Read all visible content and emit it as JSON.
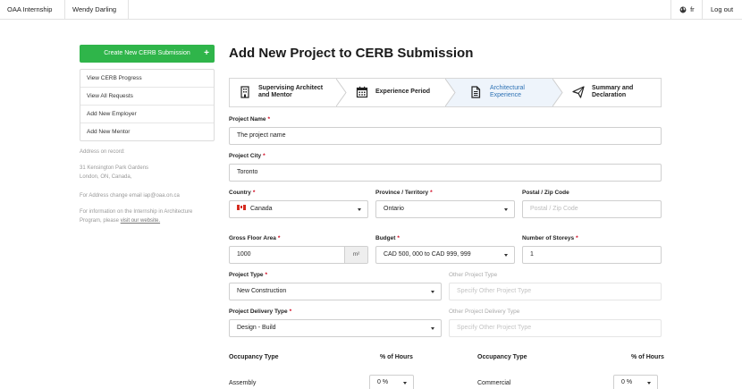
{
  "topbar": {
    "brand": "OAA Internship",
    "user": "Wendy Darling",
    "lang": "fr",
    "logout": "Log out"
  },
  "sidebar": {
    "create_button": "Create New CERB Submission",
    "create_icon": "+",
    "menu": [
      "View CERB Progress",
      "View All Requests",
      "Add New Employer",
      "Add New Mentor"
    ],
    "address_heading": "Address on record:",
    "address_line1": "31 Kensington Park Gardens",
    "address_line2": "London, ON, Canada,",
    "address_change": "For Address change email iap@oaa.on.ca",
    "info_line1": "For information on the Internship in Architecture",
    "info_line2_prefix": "Program, please ",
    "info_link": "visit our website."
  },
  "page": {
    "title": "Add New Project to CERB Submission"
  },
  "steps": [
    {
      "line1": "Supervising Architect",
      "line2": "and Mentor",
      "icon": "building-icon"
    },
    {
      "line1": "Experience Period",
      "line2": "",
      "icon": "calendar-icon"
    },
    {
      "line1": "Architectural",
      "line2": "Experience",
      "icon": "document-icon"
    },
    {
      "line1": "Summary and",
      "line2": "Declaration",
      "icon": "paper-plane-icon"
    }
  ],
  "form": {
    "project_name": {
      "label": "Project Name",
      "req": "*",
      "value": "The project name"
    },
    "project_city": {
      "label": "Project City",
      "req": "*",
      "value": "Toronto"
    },
    "country": {
      "label": "Country",
      "req": "*",
      "value": "Canada"
    },
    "province": {
      "label": "Province / Territory",
      "req": "*",
      "value": "Ontario"
    },
    "postal": {
      "label": "Postal / Zip Code",
      "placeholder": "Postal / Zip Code"
    },
    "gfa": {
      "label": "Gross Floor Area",
      "req": "*",
      "value": "1000",
      "unit": "m²"
    },
    "budget": {
      "label": "Budget",
      "req": "*",
      "value": "CAD 500, 000 to CAD 999, 999"
    },
    "storeys": {
      "label": "Number of Storeys",
      "req": "*",
      "value": "1"
    },
    "project_type": {
      "label": "Project Type",
      "req": "*",
      "value": "New Construction"
    },
    "other_type": {
      "label": "Other Project Type",
      "placeholder": "Specify Other Project Type"
    },
    "delivery_type": {
      "label": "Project Delivery Type",
      "req": "*",
      "value": "Design - Build"
    },
    "other_delivery": {
      "label": "Other Project Delivery Type",
      "placeholder": "Specify Other Project Type"
    }
  },
  "occupancy": {
    "col_type": "Occupancy Type",
    "col_hours": "% of Hours",
    "rows_left": [
      {
        "type": "Assembly",
        "hours": "0 %"
      }
    ],
    "rows_right": [
      {
        "type": "Commercial",
        "hours": "0 %"
      }
    ]
  }
}
